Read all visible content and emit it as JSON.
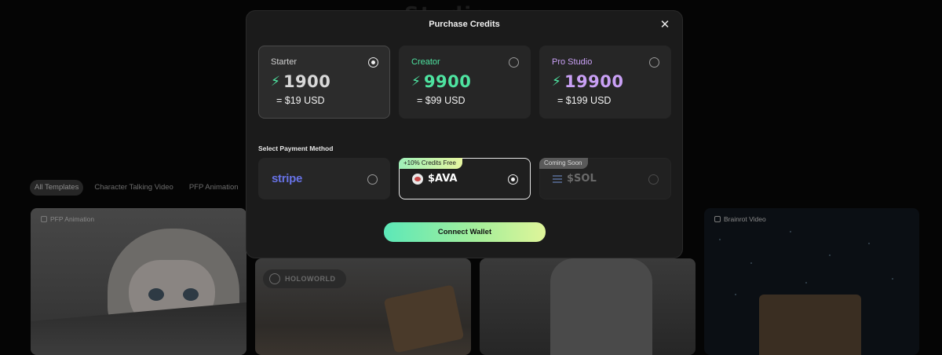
{
  "background": {
    "title": "Studio",
    "filters": [
      "All Templates",
      "Character Talking Video",
      "PFP Animation"
    ],
    "cards": [
      {
        "tag": "PFP Animation"
      },
      {
        "logo_text": "HOLOWORLD"
      },
      {},
      {
        "tag": "Brainrot Video"
      }
    ]
  },
  "modal": {
    "title": "Purchase Credits",
    "close_icon": "close-icon",
    "plans": [
      {
        "name": "Starter",
        "amount": "1900",
        "usd": "= $19 USD",
        "color": "#ffffff",
        "name_color": "#d0d0d0",
        "selected": true
      },
      {
        "name": "Creator",
        "amount": "9900",
        "usd": "= $99 USD",
        "color": "#4ee3a0",
        "name_color": "#4ee3a0",
        "selected": false
      },
      {
        "name": "Pro Studio",
        "amount": "19900",
        "usd": "= $199 USD",
        "color": "#c9a0f5",
        "name_color": "#c9a0f5",
        "selected": false
      }
    ],
    "bolt_icon": "lightning-icon",
    "payment_label": "Select Payment Method",
    "methods": [
      {
        "name": "stripe",
        "selected": false,
        "disabled": false
      },
      {
        "name": "$AVA",
        "badge": "+10% Credits Free",
        "selected": true,
        "disabled": false
      },
      {
        "name": "$SOL",
        "badge": "Coming Soon",
        "selected": false,
        "disabled": true
      }
    ],
    "connect_label": "Connect Wallet"
  }
}
